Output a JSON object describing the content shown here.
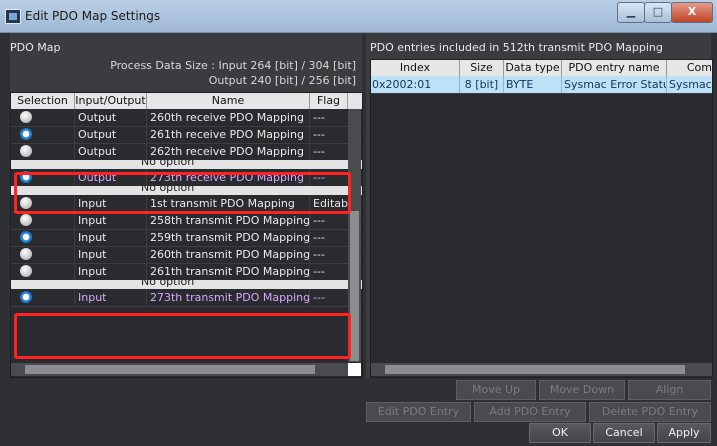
{
  "window": {
    "title": "Edit PDO Map Settings",
    "minimize": "▁",
    "maximize": "□",
    "close": "X"
  },
  "left": {
    "title": "PDO Map",
    "process_input": "Process Data Size : Input  264 [bit]  /  304 [bit]",
    "process_output": "Output  240 [bit]  /  256 [bit]",
    "headers": [
      "Selection",
      "Input/Output",
      "Name",
      "Flag"
    ],
    "rows": [
      {
        "selected": false,
        "io": "Output",
        "name": "260th receive PDO Mapping",
        "flag": "---"
      },
      {
        "selected": true,
        "io": "Output",
        "name": "261th receive PDO Mapping",
        "flag": "---"
      },
      {
        "selected": false,
        "io": "Output",
        "name": "262th receive PDO Mapping",
        "flag": "---"
      },
      {
        "separator": "No option"
      },
      {
        "selected": true,
        "io": "Output",
        "name": "273th receive PDO Mapping",
        "flag": "---",
        "highlight": true
      },
      {
        "separator": "No option"
      },
      {
        "selected": false,
        "io": "Input",
        "name": "1st transmit PDO Mapping",
        "flag": "Editab"
      },
      {
        "selected": false,
        "io": "Input",
        "name": "258th transmit PDO Mapping",
        "flag": "---"
      },
      {
        "selected": true,
        "io": "Input",
        "name": "259th transmit PDO Mapping",
        "flag": "---"
      },
      {
        "selected": false,
        "io": "Input",
        "name": "260th transmit PDO Mapping",
        "flag": "---"
      },
      {
        "selected": false,
        "io": "Input",
        "name": "261th transmit PDO Mapping",
        "flag": "---"
      },
      {
        "separator": "No option"
      },
      {
        "selected": true,
        "io": "Input",
        "name": "273th transmit PDO Mapping",
        "flag": "---",
        "highlight": true
      }
    ]
  },
  "right": {
    "title": "PDO entries included in 512th transmit PDO Mapping",
    "headers": [
      "Index",
      "Size",
      "Data type",
      "PDO entry name",
      "Com"
    ],
    "rows": [
      {
        "index": "0x2002:01",
        "size": "8 [bit]",
        "type": "BYTE",
        "name": "Sysmac Error Status",
        "comment": "Sysmac E"
      }
    ]
  },
  "buttons": {
    "move_up": "Move Up",
    "move_down": "Move Down",
    "align": "Align",
    "edit_entry": "Edit PDO Entry",
    "add_entry": "Add PDO Entry",
    "delete_entry": "Delete PDO Entry",
    "ok": "OK",
    "cancel": "Cancel",
    "apply": "Apply"
  },
  "colors": {
    "highlight_box": "#ff2222",
    "highlight_text": "#d7a7ff",
    "selected_row": "#bfe1f7"
  }
}
